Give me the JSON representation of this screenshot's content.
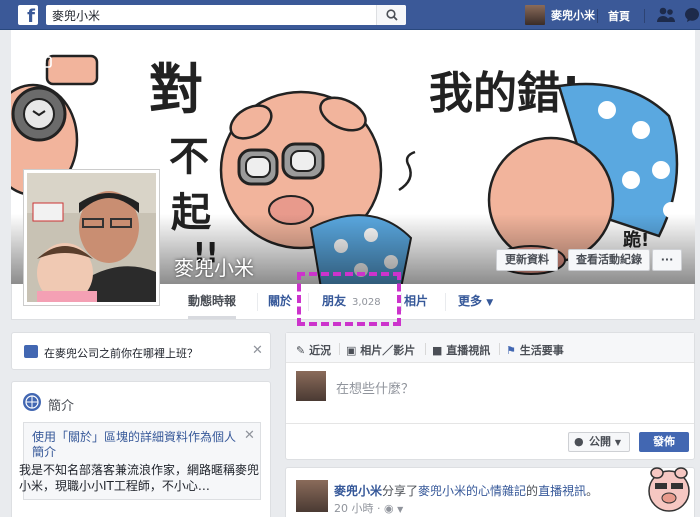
{
  "topbar": {
    "logo": "f",
    "search_value": "麥兜小米",
    "user_name": "麥兜小米",
    "home_label": "首頁",
    "colors": {
      "bar": "#3b5998"
    }
  },
  "cover": {
    "name": "麥兜小米",
    "art_text_left": [
      "對",
      "不",
      "起",
      "!!"
    ],
    "art_text_right": "我的錯!",
    "art_text_small": "跪!",
    "update_info_label": "更新資料",
    "activity_log_label": "查看活動紀錄",
    "more_label": "···"
  },
  "tabs": {
    "timeline": "動態時報",
    "about": "關於",
    "friends": "朋友",
    "friends_count": "3,028",
    "photos": "相片",
    "more": "更多"
  },
  "left": {
    "work_prompt": "在麥兜公司之前你在哪裡上班？",
    "intro_title": "簡介",
    "intro_link": "使用「關於」區塊的詳細資料作為個人簡介",
    "intro_bio": "我是不知名部落客兼流浪作家，網路暱稱麥兜小米，現職小小IT工程師，不小心…"
  },
  "composer": {
    "tab_status": "近況",
    "tab_photo": "相片／影片",
    "tab_live": "直播視訊",
    "tab_event": "生活要事",
    "placeholder": "在想些什麼？",
    "privacy": "公開",
    "post": "發佈"
  },
  "story": {
    "author": "麥兜小米",
    "text1": "分享了",
    "page": "麥兜小米的心情雜記",
    "text2": "的",
    "link": "直播視訊",
    "text3": "。",
    "time": "20 小時 · "
  }
}
